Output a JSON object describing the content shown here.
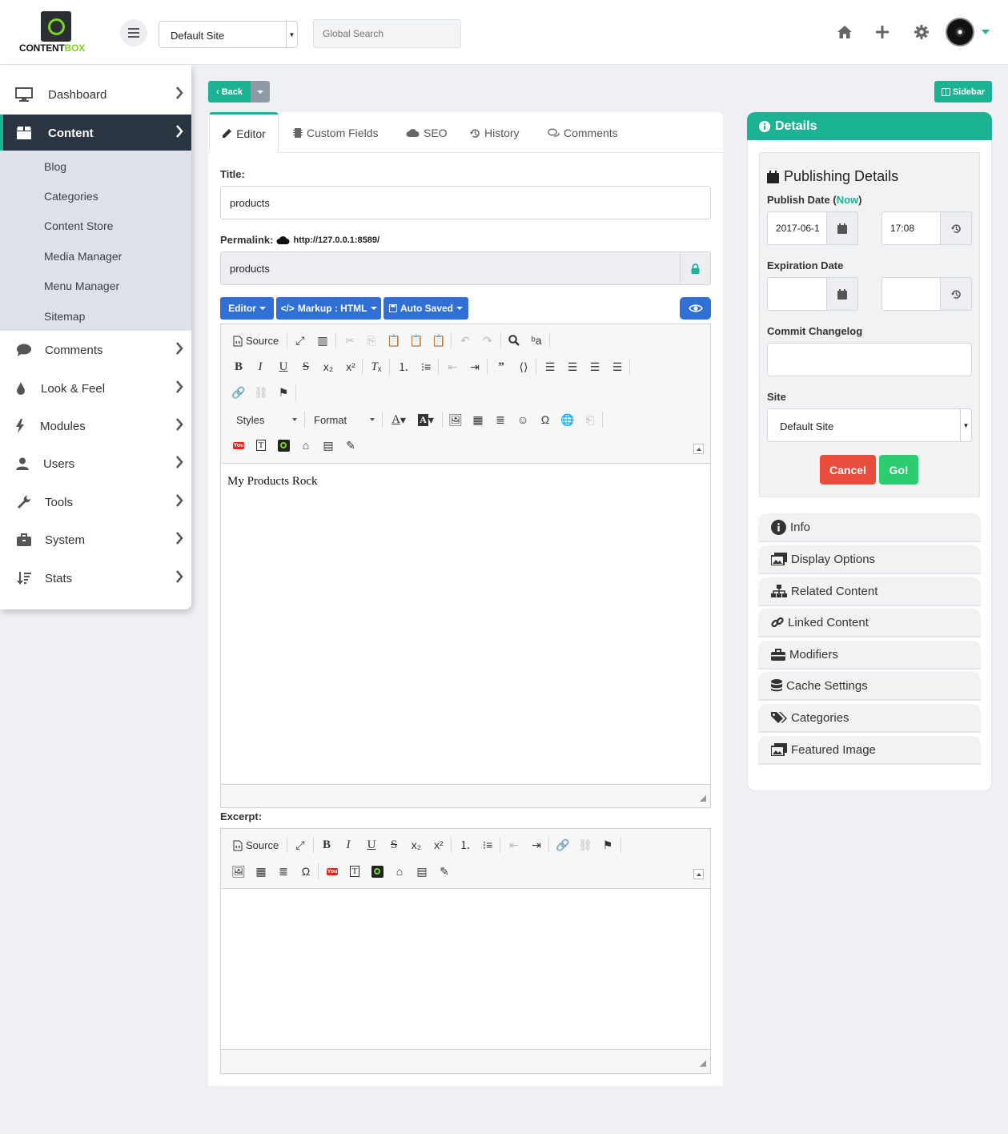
{
  "brand": {
    "logo_text_a": "CONTENT",
    "logo_text_b": "BOX",
    "accent": "#1bb394",
    "logo_green": "#7ed321"
  },
  "header": {
    "site_selector": "Default Site",
    "search_placeholder": "Global Search"
  },
  "sidebar": {
    "items": [
      {
        "label": "Dashboard",
        "icon": "monitor-icon"
      },
      {
        "label": "Content",
        "icon": "box-icon",
        "active": true
      },
      {
        "label": "Comments",
        "icon": "comment-icon"
      },
      {
        "label": "Look & Feel",
        "icon": "droplet-icon"
      },
      {
        "label": "Modules",
        "icon": "bolt-icon"
      },
      {
        "label": "Users",
        "icon": "user-icon"
      },
      {
        "label": "Tools",
        "icon": "wrench-icon"
      },
      {
        "label": "System",
        "icon": "briefcase-icon"
      },
      {
        "label": "Stats",
        "icon": "sort-icon"
      }
    ],
    "sub_items": [
      "Blog",
      "Categories",
      "Content Store",
      "Media Manager",
      "Menu Manager",
      "Sitemap"
    ]
  },
  "toolbar": {
    "back_label": "Back",
    "sidebar_label": "Sidebar"
  },
  "tabs": [
    "Editor",
    "Custom Fields",
    "SEO",
    "History",
    "Comments"
  ],
  "form": {
    "title_label": "Title:",
    "title_value": "products",
    "permalink_label": "Permalink:",
    "permalink_url": "http://127.0.0.1:8589/",
    "slug_value": "products",
    "editor_btn": "Editor",
    "markup_btn": "Markup : HTML",
    "autosave_btn": "Auto Saved",
    "source_label": "Source",
    "styles_label": "Styles",
    "format_label": "Format",
    "content_text": "My Products Rock",
    "excerpt_label": "Excerpt:"
  },
  "details": {
    "header": "Details",
    "publishing_title": "Publishing Details",
    "publish_date_label": "Publish Date (",
    "now_label": "Now",
    "publish_date_close": ")",
    "publish_date_value": "2017-06-1",
    "publish_time_value": "17:08",
    "expiration_label": "Expiration Date",
    "changelog_label": "Commit Changelog",
    "site_label": "Site",
    "site_value": "Default Site",
    "cancel_label": "Cancel",
    "go_label": "Go!",
    "sections": [
      "Info",
      "Display Options",
      "Related Content",
      "Linked Content",
      "Modifiers",
      "Cache Settings",
      "Categories",
      "Featured Image"
    ]
  }
}
